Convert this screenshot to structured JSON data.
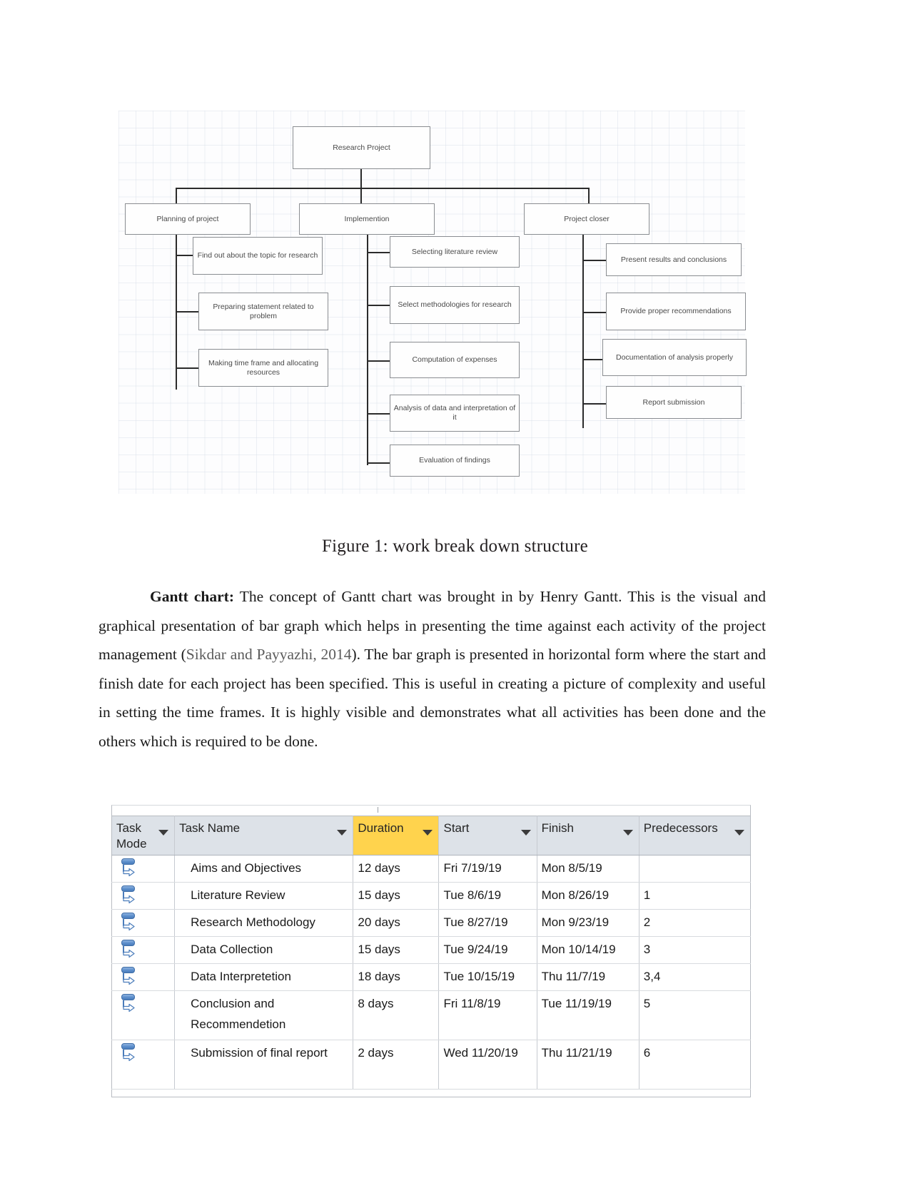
{
  "figure": {
    "caption": "Figure 1: work break down structure",
    "wbs": {
      "root": "Research Project",
      "branches": [
        {
          "title": "Planning of project",
          "children": [
            "Find out about the topic for research",
            "Preparing statement related to problem",
            "Making time frame and allocating resources"
          ]
        },
        {
          "title": "Implemention",
          "children": [
            "Selecting literature review",
            "Select methodologies for research",
            "Computation of expenses",
            "Analysis of data and interpretation of it",
            "Evaluation of findings"
          ]
        },
        {
          "title": "Project closer",
          "children": [
            "Present results and conclusions",
            "Provide proper recommendations",
            "Documentation of analysis properly",
            "Report submission"
          ]
        }
      ]
    }
  },
  "paragraph": {
    "lead_bold": "Gantt chart:",
    "text_before_cite": " The concept of Gantt chart was brought in by Henry Gantt. This is the visual and graphical presentation of bar graph which helps in presenting the time against each activity of the project management (",
    "citation": "Sikdar and Payyazhi, 2014",
    "text_after_cite": "). The bar graph is presented in horizontal form where the start and finish date for each project has been specified. This is useful in creating a picture of complexity and useful in setting the time frames. It is highly visible and demonstrates what all activities has been done and the others which is required to be done."
  },
  "gantt_table": {
    "highlight_color": "#ffd34d",
    "header_bg": "#dde2e8",
    "columns": [
      {
        "label": "Task Mode",
        "filter_icon": "chevron-down-icon",
        "highlighted": false
      },
      {
        "label": "Task Name",
        "filter_icon": "chevron-down-icon",
        "highlighted": false
      },
      {
        "label": "Duration",
        "filter_icon": "chevron-down-icon",
        "highlighted": true
      },
      {
        "label": "Start",
        "filter_icon": "chevron-down-icon",
        "highlighted": false
      },
      {
        "label": "Finish",
        "filter_icon": "chevron-down-icon",
        "highlighted": false
      },
      {
        "label": "Predecessors",
        "filter_icon": "chevron-down-icon",
        "highlighted": false
      }
    ],
    "rows": [
      {
        "mode_icon": "auto-scheduled-icon",
        "name": "Aims and Objectives",
        "duration": "12 days",
        "start": "Fri 7/19/19",
        "finish": "Mon 8/5/19",
        "predecessors": ""
      },
      {
        "mode_icon": "auto-scheduled-icon",
        "name": "Literature Review",
        "duration": "15 days",
        "start": "Tue 8/6/19",
        "finish": "Mon 8/26/19",
        "predecessors": "1"
      },
      {
        "mode_icon": "auto-scheduled-icon",
        "name": "Research Methodology",
        "duration": "20 days",
        "start": "Tue 8/27/19",
        "finish": "Mon 9/23/19",
        "predecessors": "2"
      },
      {
        "mode_icon": "auto-scheduled-icon",
        "name": "Data Collection",
        "duration": "15 days",
        "start": "Tue 9/24/19",
        "finish": "Mon 10/14/19",
        "predecessors": "3"
      },
      {
        "mode_icon": "auto-scheduled-icon",
        "name": "Data Interpretetion",
        "duration": "18 days",
        "start": "Tue 10/15/19",
        "finish": "Thu 11/7/19",
        "predecessors": "3,4"
      },
      {
        "mode_icon": "auto-scheduled-icon",
        "name": "Conclusion and Recommendetion",
        "duration": "8 days",
        "start": "Fri 11/8/19",
        "finish": "Tue 11/19/19",
        "predecessors": "5"
      },
      {
        "mode_icon": "auto-scheduled-icon",
        "name": "Submission of final report",
        "duration": "2 days",
        "start": "Wed 11/20/19",
        "finish": "Thu 11/21/19",
        "predecessors": "6"
      }
    ]
  }
}
